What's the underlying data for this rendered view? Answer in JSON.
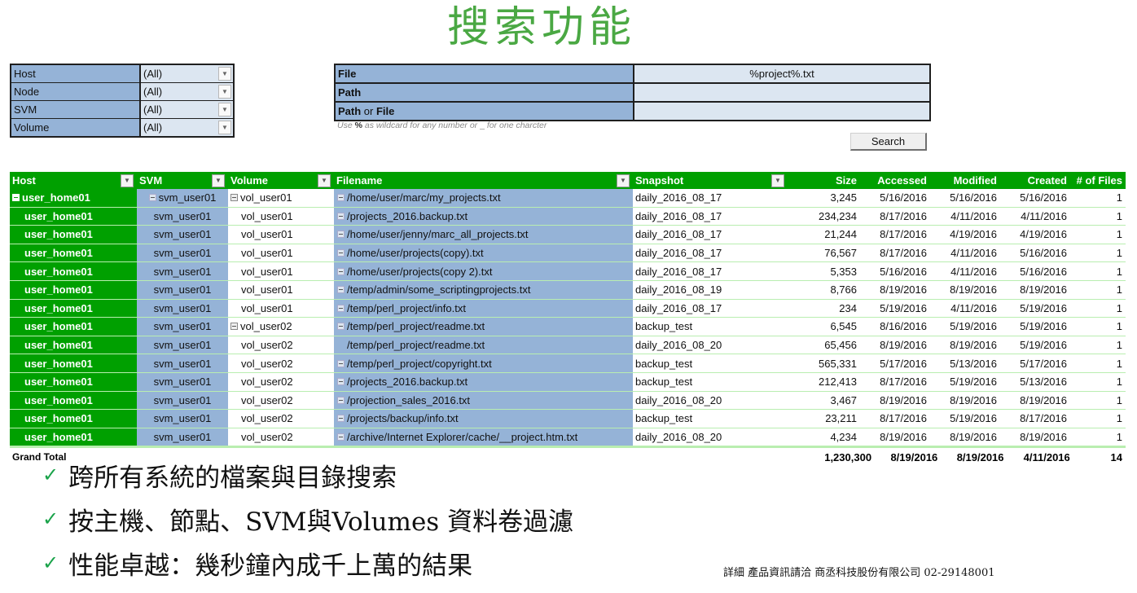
{
  "title": "搜索功能",
  "filters": [
    {
      "label": "Host",
      "value": "(All)"
    },
    {
      "label": "Node",
      "value": "(All)"
    },
    {
      "label": "SVM",
      "value": "(All)"
    },
    {
      "label": "Volume",
      "value": "(All)"
    }
  ],
  "search": {
    "file_label": "File",
    "file_value": "%project%.txt",
    "path_label": "Path",
    "path_value": "",
    "pathorfile_label_a": "Path",
    "pathorfile_label_or": " or ",
    "pathorfile_label_b": "File",
    "pathorfile_value": "",
    "hint_prefix": "Use ",
    "hint_wild": "%",
    "hint_mid": " as wildcard for any number or ",
    "hint_single": "_",
    "hint_suffix": " for one charcter",
    "button_label": "Search"
  },
  "table": {
    "headers": {
      "host": "Host",
      "svm": "SVM",
      "volume": "Volume",
      "filename": "Filename",
      "snapshot": "Snapshot",
      "size": "Size",
      "accessed": "Accessed",
      "modified": "Modified",
      "created": "Created",
      "count": "# of Files"
    },
    "rows": [
      {
        "host": "user_home01",
        "svm": "svm_user01",
        "volume": "vol_user01",
        "filename": "/home/user/marc/my_projects.txt",
        "snapshot": "daily_2016_08_17",
        "size": "3,245",
        "accessed": "5/16/2016",
        "modified": "5/16/2016",
        "created": "5/16/2016",
        "count": "1"
      },
      {
        "host": "user_home01",
        "svm": "svm_user01",
        "volume": "vol_user01",
        "filename": "/projects_2016.backup.txt",
        "snapshot": "daily_2016_08_17",
        "size": "234,234",
        "accessed": "8/17/2016",
        "modified": "4/11/2016",
        "created": "4/11/2016",
        "count": "1"
      },
      {
        "host": "user_home01",
        "svm": "svm_user01",
        "volume": "vol_user01",
        "filename": "/home/user/jenny/marc_all_projects.txt",
        "snapshot": "daily_2016_08_17",
        "size": "21,244",
        "accessed": "8/17/2016",
        "modified": "4/19/2016",
        "created": "4/19/2016",
        "count": "1"
      },
      {
        "host": "user_home01",
        "svm": "svm_user01",
        "volume": "vol_user01",
        "filename": "/home/user/projects(copy).txt",
        "snapshot": "daily_2016_08_17",
        "size": "76,567",
        "accessed": "8/17/2016",
        "modified": "4/11/2016",
        "created": "5/16/2016",
        "count": "1"
      },
      {
        "host": "user_home01",
        "svm": "svm_user01",
        "volume": "vol_user01",
        "filename": "/home/user/projects(copy 2).txt",
        "snapshot": "daily_2016_08_17",
        "size": "5,353",
        "accessed": "5/16/2016",
        "modified": "4/11/2016",
        "created": "5/16/2016",
        "count": "1"
      },
      {
        "host": "user_home01",
        "svm": "svm_user01",
        "volume": "vol_user01",
        "filename": "/temp/admin/some_scriptingprojects.txt",
        "snapshot": "daily_2016_08_19",
        "size": "8,766",
        "accessed": "8/19/2016",
        "modified": "8/19/2016",
        "created": "8/19/2016",
        "count": "1"
      },
      {
        "host": "user_home01",
        "svm": "svm_user01",
        "volume": "vol_user01",
        "filename": "/temp/perl_project/info.txt",
        "snapshot": "daily_2016_08_17",
        "size": "234",
        "accessed": "5/19/2016",
        "modified": "4/11/2016",
        "created": "5/19/2016",
        "count": "1"
      },
      {
        "host": "user_home01",
        "svm": "svm_user01",
        "volume": "vol_user02",
        "filename": "/temp/perl_project/readme.txt",
        "snapshot": "backup_test",
        "size": "6,545",
        "accessed": "8/16/2016",
        "modified": "5/19/2016",
        "created": "5/19/2016",
        "count": "1"
      },
      {
        "host": "user_home01",
        "svm": "svm_user01",
        "volume": "vol_user02",
        "filename": "/temp/perl_project/readme.txt",
        "snapshot": "daily_2016_08_20",
        "size": "65,456",
        "accessed": "8/19/2016",
        "modified": "8/19/2016",
        "created": "5/19/2016",
        "count": "1"
      },
      {
        "host": "user_home01",
        "svm": "svm_user01",
        "volume": "vol_user02",
        "filename": "/temp/perl_project/copyright.txt",
        "snapshot": "backup_test",
        "size": "565,331",
        "accessed": "5/17/2016",
        "modified": "5/13/2016",
        "created": "5/17/2016",
        "count": "1"
      },
      {
        "host": "user_home01",
        "svm": "svm_user01",
        "volume": "vol_user02",
        "filename": "/projects_2016.backup.txt",
        "snapshot": "backup_test",
        "size": "212,413",
        "accessed": "8/17/2016",
        "modified": "5/19/2016",
        "created": "5/13/2016",
        "count": "1"
      },
      {
        "host": "user_home01",
        "svm": "svm_user01",
        "volume": "vol_user02",
        "filename": "/projection_sales_2016.txt",
        "snapshot": "daily_2016_08_20",
        "size": "3,467",
        "accessed": "8/19/2016",
        "modified": "8/19/2016",
        "created": "8/19/2016",
        "count": "1"
      },
      {
        "host": "user_home01",
        "svm": "svm_user01",
        "volume": "vol_user02",
        "filename": "/projects/backup/info.txt",
        "snapshot": "backup_test",
        "size": "23,211",
        "accessed": "8/17/2016",
        "modified": "5/19/2016",
        "created": "8/17/2016",
        "count": "1"
      },
      {
        "host": "user_home01",
        "svm": "svm_user01",
        "volume": "vol_user02",
        "filename": "/archive/Internet Explorer/cache/__project.htm.txt",
        "snapshot": "daily_2016_08_20",
        "size": "4,234",
        "accessed": "8/19/2016",
        "modified": "8/19/2016",
        "created": "8/19/2016",
        "count": "1"
      }
    ],
    "total": {
      "label": "Grand Total",
      "size": "1,230,300",
      "accessed": "8/19/2016",
      "modified": "8/19/2016",
      "created": "4/11/2016",
      "count": "14"
    }
  },
  "bullets": [
    "跨所有系統的檔案與目錄搜索",
    "按主機、節點、SVM與Volumes 資料卷過濾",
    "性能卓越：幾秒鐘內成千上萬的結果"
  ],
  "footer": "詳細 產品資訊請洽 商丞科技股份有限公司 02-29148001",
  "colors": {
    "title": "#4aa843",
    "header_green": "#00a000",
    "label_blue": "#95b3d7",
    "value_blue": "#dce6f1",
    "check": "#1aa34a"
  }
}
